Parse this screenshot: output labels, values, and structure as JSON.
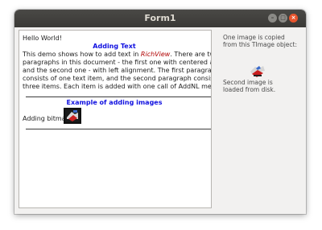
{
  "window": {
    "title": "Form1",
    "controls": {
      "minimize_glyph": "–",
      "maximize_glyph": "□",
      "close_glyph": "×"
    }
  },
  "richview": {
    "greeting": "Hello World!",
    "heading1": "Adding Text",
    "para": {
      "line1_before": "This demo shows how to add text in ",
      "line1_italic": "RichView",
      "line1_after": ". There are two",
      "line2": "paragraphs in this document - the first one with centered alignment,",
      "line3": "and the second one - with left alignment. The first paragraph",
      "line4": "consists of one text item, and the second paragraph consists of",
      "line5": "three items. Each item is added with one call of AddNL method."
    },
    "heading2": "Example of adding images",
    "bitmap_label": "Adding bitmap"
  },
  "side": {
    "copied_line1": "One image is copied",
    "copied_line2": "from this TImage object:",
    "loaded_line1": "Second image is",
    "loaded_line2": "loaded from disk."
  },
  "colors": {
    "heading": "#1010e0",
    "italic_text": "#b00000",
    "titlebar": "#3c3b37",
    "close_button": "#e9552e"
  }
}
